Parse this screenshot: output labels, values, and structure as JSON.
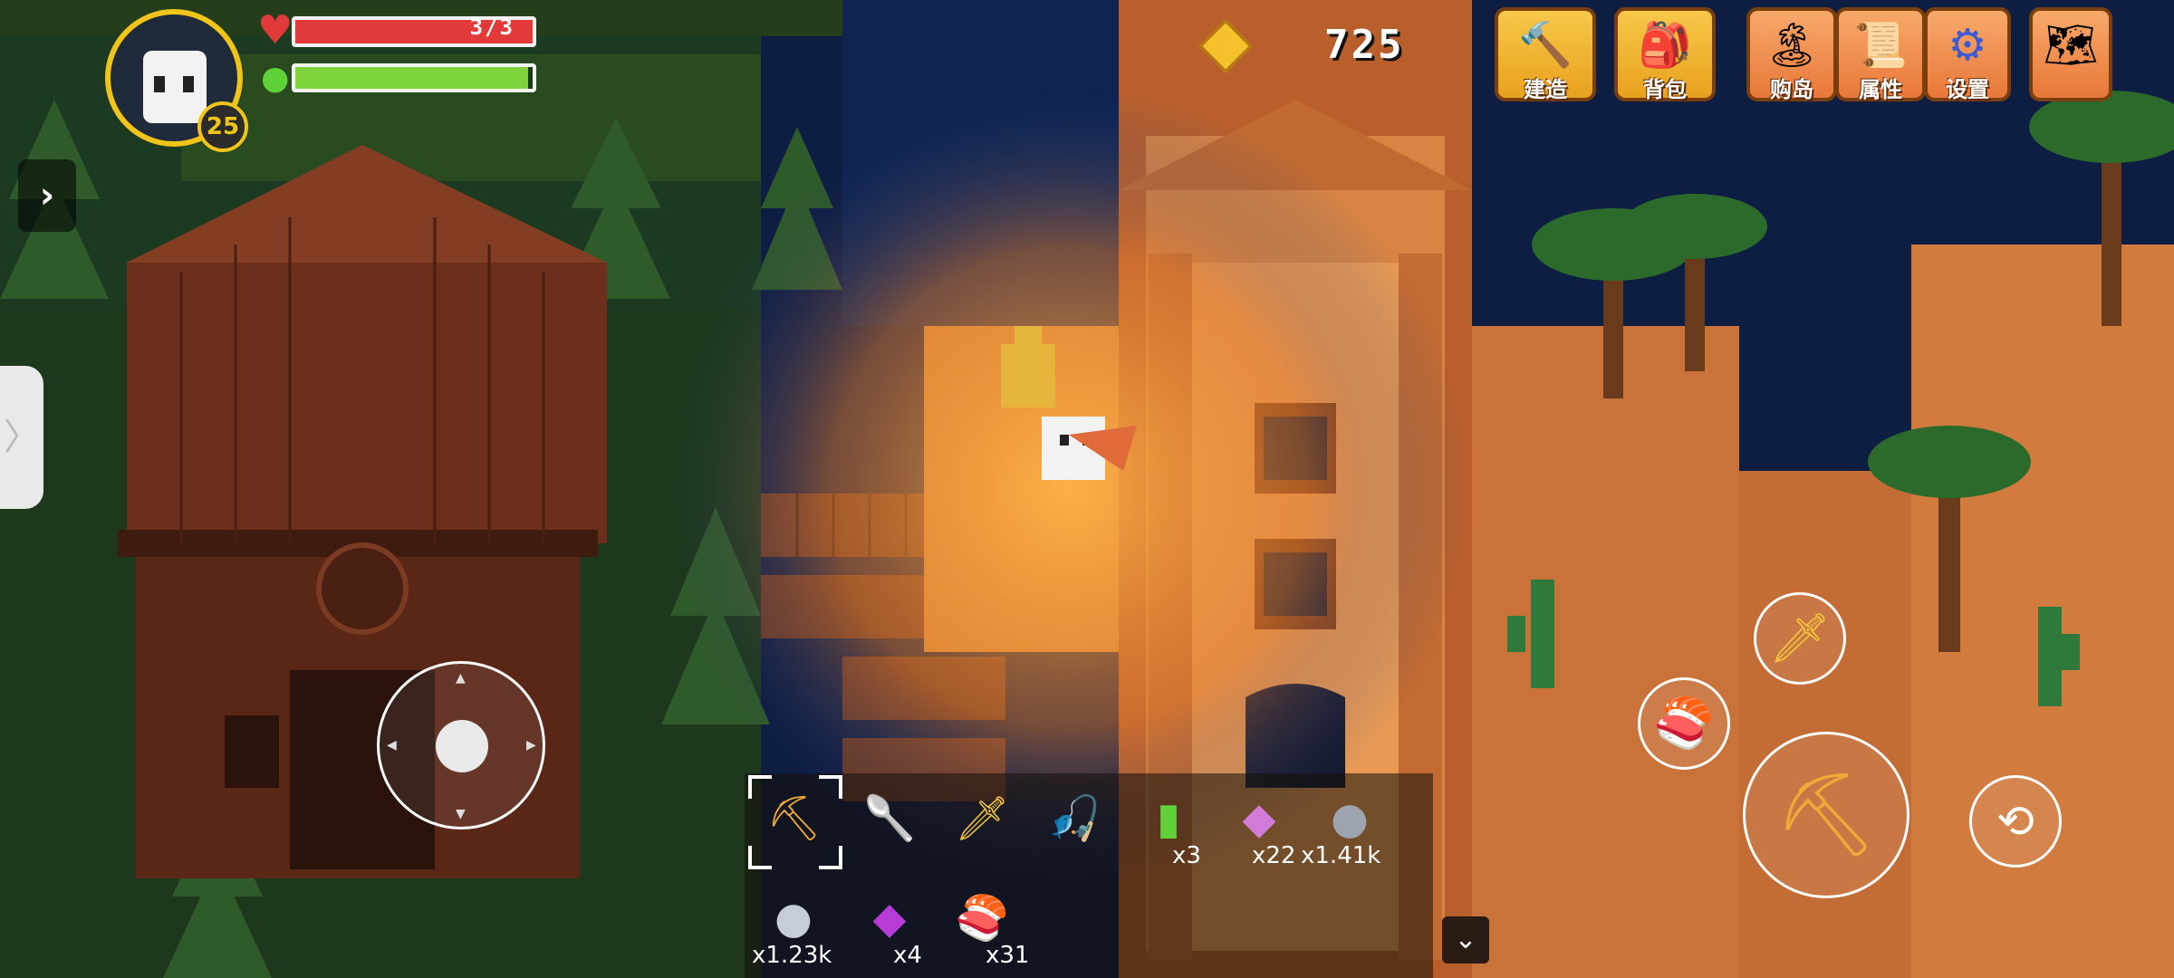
{
  "player": {
    "level": "25",
    "hp_text": "3/3",
    "hp_fraction": 1.0,
    "energy_fraction": 0.98
  },
  "currency": {
    "amount": "725",
    "icon": "gem-icon"
  },
  "menu": [
    {
      "id": "build",
      "label": "建造",
      "icon": "anvil-icon",
      "style": "gold"
    },
    {
      "id": "backpack",
      "label": "背包",
      "icon": "backpack-icon",
      "style": "gold"
    },
    {
      "id": "buy-island",
      "label": "购岛",
      "icon": "island-icon",
      "style": "orange"
    },
    {
      "id": "attributes",
      "label": "属性",
      "icon": "skull-scroll-icon",
      "style": "orange"
    },
    {
      "id": "settings",
      "label": "设置",
      "icon": "gear-icon",
      "style": "orange"
    },
    {
      "id": "quests",
      "label": "",
      "icon": "map-scroll-icon",
      "style": "orange"
    }
  ],
  "hotbar": {
    "row1": [
      {
        "icon": "pickaxe-icon",
        "count": "",
        "selected": true
      },
      {
        "icon": "shovel-icon",
        "count": ""
      },
      {
        "icon": "sword-icon",
        "count": ""
      },
      {
        "icon": "fishing-rod-icon",
        "count": ""
      },
      {
        "icon": "emerald-icon",
        "count": "x3"
      },
      {
        "icon": "crystal-icon",
        "count": "x22"
      },
      {
        "icon": "stone-icon",
        "count": "x1.41k"
      }
    ],
    "row2": [
      {
        "icon": "iron-ore-icon",
        "count": "x1.23k"
      },
      {
        "icon": "amethyst-icon",
        "count": "x4"
      },
      {
        "icon": "sushi-icon",
        "count": "x31"
      }
    ]
  },
  "actions": {
    "sword": "sword-icon",
    "sushi": "sushi-icon",
    "main": "pickaxe-icon",
    "roll": "dodge-icon"
  },
  "colors": {
    "hp": "#e23a3a",
    "energy": "#7fd43c",
    "gold_button": "#f0b531",
    "orange_button": "#ef8a4b",
    "night_water": "#0d1a3a",
    "sand": "#d9844a"
  }
}
